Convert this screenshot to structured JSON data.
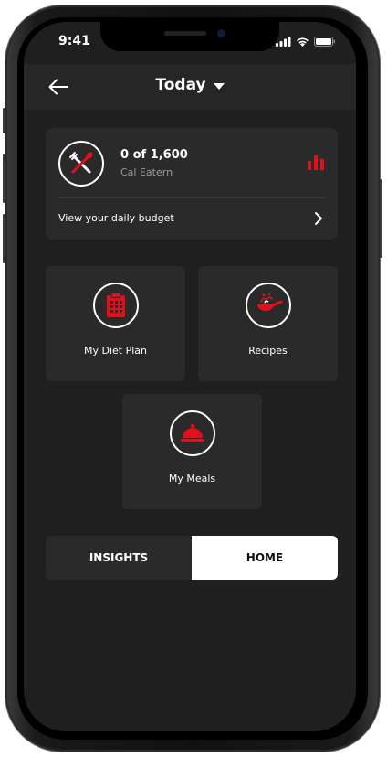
{
  "status_bar": {
    "time": "9:41"
  },
  "header": {
    "title": "Today"
  },
  "budget": {
    "value": "0 of 1,600",
    "subtitle": "Cal Eatern",
    "link_label": "View your daily budget"
  },
  "tiles": [
    {
      "label": "My Diet Plan",
      "icon": "diet-plan-icon"
    },
    {
      "label": "Recipes",
      "icon": "recipes-pan-icon"
    },
    {
      "label": "My Meals",
      "icon": "meals-cloche-icon"
    }
  ],
  "segment": {
    "insights_label": "INSIGHTS",
    "home_label": "HOME",
    "active": "HOME"
  },
  "colors": {
    "accent": "#e3101b",
    "background": "#1f1f1f",
    "card": "#2a2a2a",
    "header": "#262626"
  }
}
